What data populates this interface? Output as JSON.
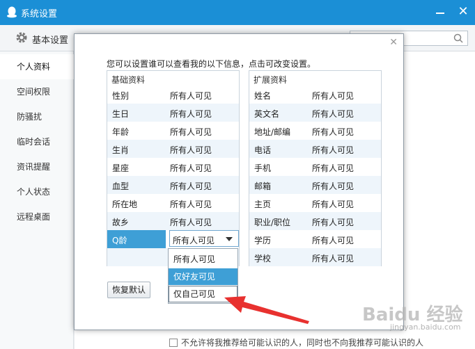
{
  "window": {
    "title": "系统设置"
  },
  "toolbar": {
    "tab_basic": "基本设置"
  },
  "sidebar": {
    "items": [
      {
        "label": "个人资料"
      },
      {
        "label": "空间权限"
      },
      {
        "label": "防骚扰"
      },
      {
        "label": "临时会话"
      },
      {
        "label": "资讯提醒"
      },
      {
        "label": "个人状态"
      },
      {
        "label": "远程桌面"
      }
    ]
  },
  "bottom_hint": "不允许将我推荐给可能认识的人，同时也不向我推荐可能认识的人",
  "dialog": {
    "intro": "您可以设置谁可以查看我的以下信息，点击可改变设置。",
    "basic": {
      "title": "基础资料",
      "rows": [
        {
          "name": "性别",
          "value": "所有人可见"
        },
        {
          "name": "生日",
          "value": "所有人可见"
        },
        {
          "name": "年龄",
          "value": "所有人可见"
        },
        {
          "name": "生肖",
          "value": "所有人可见"
        },
        {
          "name": "星座",
          "value": "所有人可见"
        },
        {
          "name": "血型",
          "value": "所有人可见"
        },
        {
          "name": "所在地",
          "value": "所有人可见"
        },
        {
          "name": "故乡",
          "value": "所有人可见"
        }
      ],
      "selected_row": {
        "name": "Q龄",
        "value": "所有人可见"
      }
    },
    "extended": {
      "title": "扩展资料",
      "rows": [
        {
          "name": "姓名",
          "value": "所有人可见"
        },
        {
          "name": "英文名",
          "value": "所有人可见"
        },
        {
          "name": "地址/邮编",
          "value": "所有人可见"
        },
        {
          "name": "电话",
          "value": "所有人可见"
        },
        {
          "name": "手机",
          "value": "所有人可见"
        },
        {
          "name": "邮箱",
          "value": "所有人可见"
        },
        {
          "name": "主页",
          "value": "所有人可见"
        },
        {
          "name": "职业/职位",
          "value": "所有人可见"
        },
        {
          "name": "学历",
          "value": "所有人可见"
        },
        {
          "name": "学校",
          "value": "所有人可见"
        }
      ]
    },
    "dropdown_options": [
      "所有人可见",
      "仅好友可见",
      "仅自己可见"
    ],
    "reset_label": "恢复默认"
  },
  "watermark": {
    "brand": "Baidu 经验",
    "url": "jingyan.baidu.com"
  },
  "colors": {
    "titlebar": "#1b8fd6",
    "selection": "#3e9fd6",
    "arrow": "#e8312f"
  }
}
